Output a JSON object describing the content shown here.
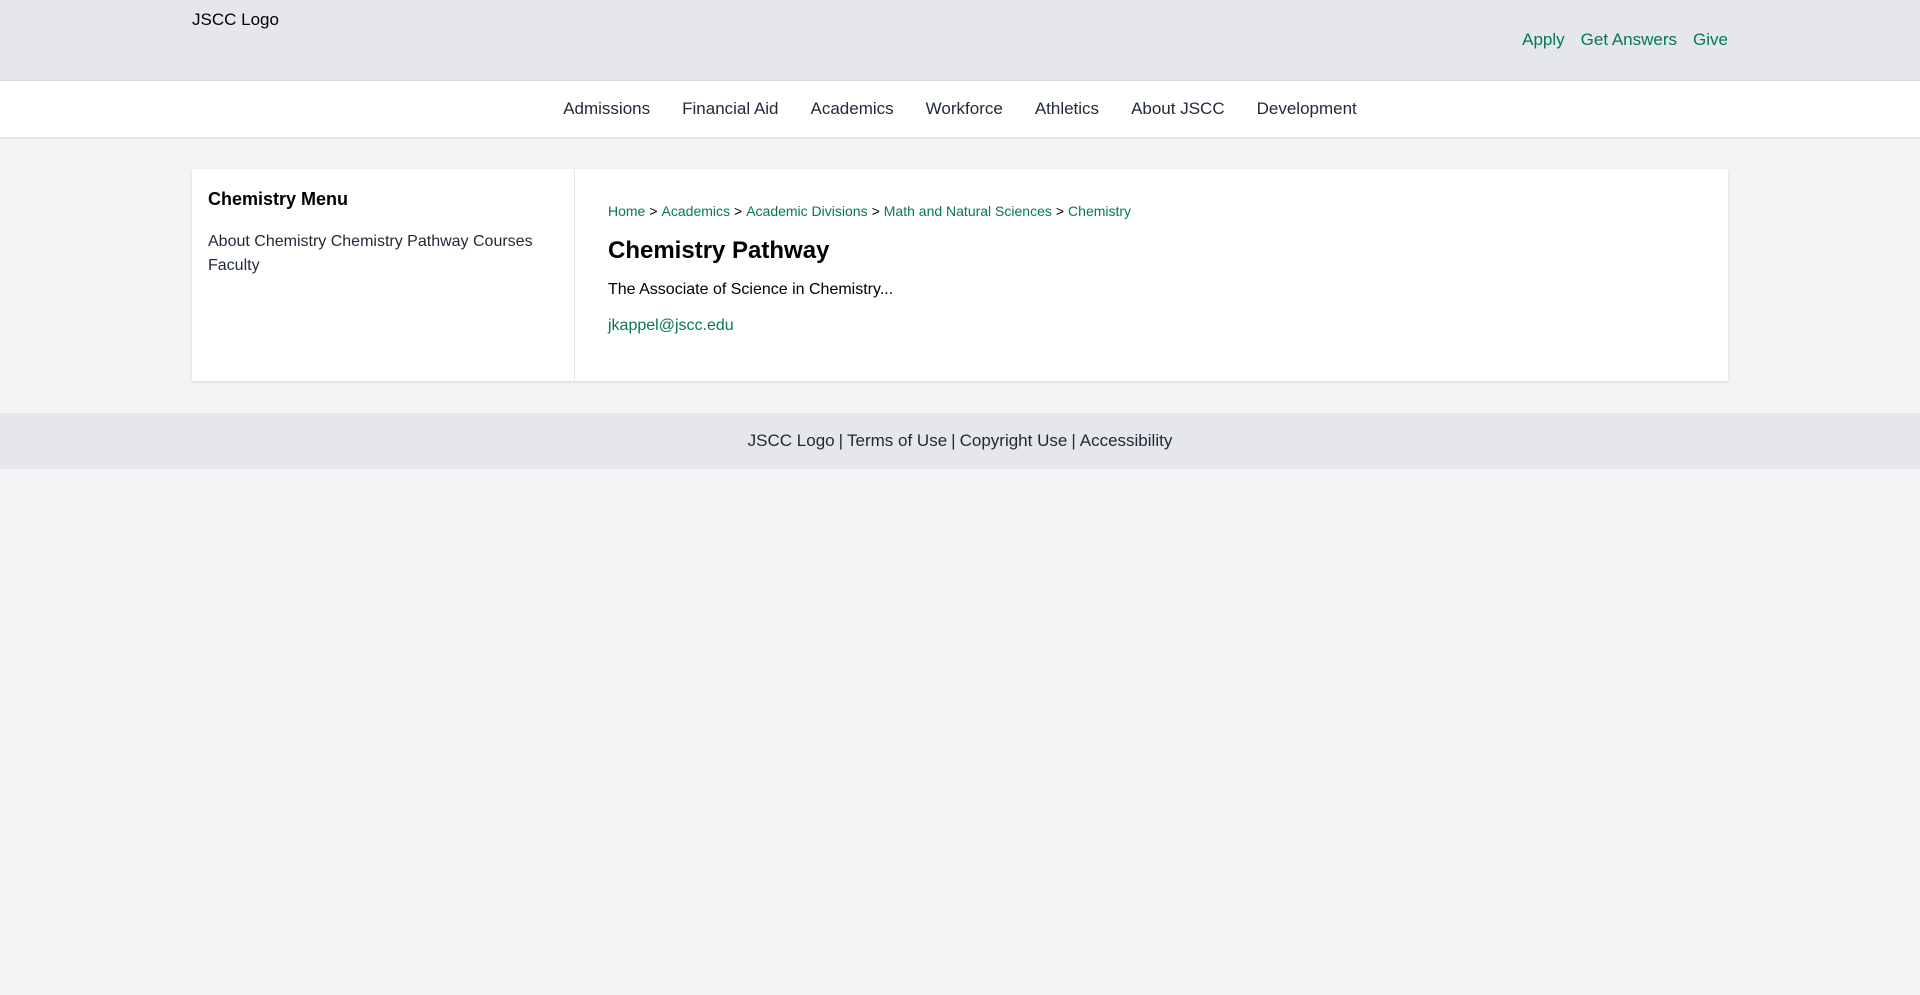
{
  "header": {
    "logo_text": "JSCC Logo",
    "utility_links": [
      "Apply",
      "Get Answers",
      "Give"
    ]
  },
  "nav": {
    "items": [
      "Admissions",
      "Financial Aid",
      "Academics",
      "Workforce",
      "Athletics",
      "About JSCC",
      "Development"
    ]
  },
  "sidebar": {
    "title": "Chemistry Menu",
    "links": [
      "About Chemistry",
      "Chemistry Pathway",
      "Courses",
      "Faculty"
    ]
  },
  "breadcrumb": {
    "items": [
      "Home",
      "Academics",
      "Academic Divisions",
      "Math and Natural Sciences",
      "Chemistry"
    ],
    "separator": ">"
  },
  "main": {
    "title": "Chemistry Pathway",
    "description": "The Associate of Science in Chemistry...",
    "email": "jkappel@jscc.edu"
  },
  "footer": {
    "items": [
      "JSCC Logo",
      "Terms of Use",
      "Copyright Use",
      "Accessibility"
    ],
    "separator": "|"
  },
  "colors": {
    "link_green": "#047857",
    "header_bg": "#e5e7eb",
    "page_bg": "#f3f4f6"
  }
}
